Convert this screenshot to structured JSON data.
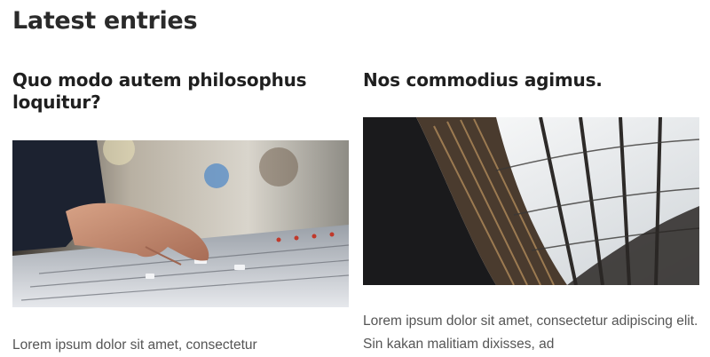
{
  "section": {
    "title": "Latest entries"
  },
  "entries": [
    {
      "title": "Quo modo autem philosophus loquitur?",
      "image_icon": "mixing-console-photo",
      "excerpt": "Lorem ipsum dolor sit amet, consectetur"
    },
    {
      "title": "Nos commodius agimus.",
      "image_icon": "library-bookshelves-photo",
      "excerpt": "Lorem ipsum dolor sit amet, consectetur adipiscing elit. Sin kakan malitiam dixisses, ad"
    }
  ]
}
